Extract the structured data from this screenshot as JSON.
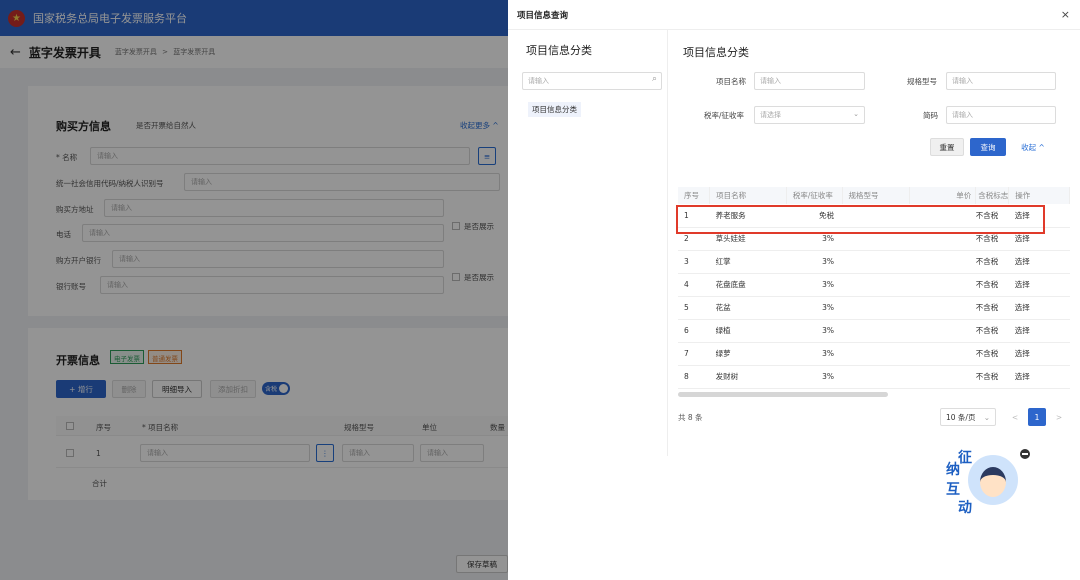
{
  "header": {
    "site_title": "国家税务总局电子发票服务平台"
  },
  "subheader": {
    "back_icon": "←",
    "page_title": "蓝字发票开具",
    "crumb_1": "蓝字发票开具",
    "crumb_sep": ">",
    "crumb_2": "蓝字发票开具"
  },
  "buyer": {
    "section_title": "购买方信息",
    "natural_person_label": "是否开票给自然人",
    "collapse_more": "收起更多 ^",
    "name_label": "* 名称",
    "name_placeholder": "请输入",
    "tax_id_label": "统一社会信用代码/纳税人识别号",
    "tax_id_placeholder": "请输入",
    "address_label": "购买方地址",
    "address_placeholder": "请输入",
    "phone_label": "电话",
    "phone_placeholder": "请输入",
    "show_label_1": "是否展示",
    "bank_label": "购方开户银行",
    "bank_placeholder": "请输入",
    "account_label": "银行账号",
    "account_placeholder": "请输入",
    "show_label_2": "是否展示"
  },
  "invoice": {
    "section_title": "开票信息",
    "tag_electronic": "电子发票",
    "tag_normal": "普通发票",
    "add_row": "+ 增行",
    "delete": "删除",
    "import_details": "明细导入",
    "add_discount": "添加折扣",
    "tax_included_toggle": "含税",
    "col_seq": "序号",
    "col_item_name": "* 项目名称",
    "col_spec": "规格型号",
    "col_unit": "单位",
    "col_qty": "数量",
    "row_seq": "1",
    "row_placeholder": "请输入",
    "total_label": "合计"
  },
  "footer": {
    "save_draft": "保存草稿"
  },
  "modal": {
    "title": "项目信息查询",
    "close": "×",
    "left_title": "项目信息分类",
    "search_placeholder": "请输入",
    "tree_item": "项目信息分类",
    "right_title": "项目信息分类",
    "q_item_name_label": "项目名称",
    "q_item_name_placeholder": "请输入",
    "q_spec_label": "规格型号",
    "q_spec_placeholder": "请输入",
    "q_tax_rate_label": "税率/征收率",
    "q_tax_rate_placeholder": "请选择",
    "q_short_code_label": "简码",
    "q_short_code_placeholder": "请输入",
    "reset": "重置",
    "query": "查询",
    "collapse": "收起 ^",
    "columns": [
      "序号",
      "项目名称",
      "税率/征收率",
      "规格型号",
      "单价",
      "含税标志",
      "操作"
    ],
    "rows": [
      {
        "seq": "1",
        "name": "养老服务",
        "rate": "免税",
        "tax": "不含税",
        "op": "选择"
      },
      {
        "seq": "2",
        "name": "草头娃娃",
        "rate": "3%",
        "tax": "不含税",
        "op": "选择"
      },
      {
        "seq": "3",
        "name": "红掌",
        "rate": "3%",
        "tax": "不含税",
        "op": "选择"
      },
      {
        "seq": "4",
        "name": "花盘底盘",
        "rate": "3%",
        "tax": "不含税",
        "op": "选择"
      },
      {
        "seq": "5",
        "name": "花盆",
        "rate": "3%",
        "tax": "不含税",
        "op": "选择"
      },
      {
        "seq": "6",
        "name": "绿植",
        "rate": "3%",
        "tax": "不含税",
        "op": "选择"
      },
      {
        "seq": "7",
        "name": "绿萝",
        "rate": "3%",
        "tax": "不含税",
        "op": "选择"
      },
      {
        "seq": "8",
        "name": "发财树",
        "rate": "3%",
        "tax": "不含税",
        "op": "选择"
      }
    ],
    "total": "共 8 条",
    "page_size": "10 条/页",
    "page_prev": "<",
    "page_current": "1",
    "page_next": ">"
  },
  "mascot": {
    "chars": [
      "征",
      "纳",
      "互",
      "动"
    ]
  },
  "colors": {
    "primary": "#2d66cc",
    "highlight": "#e03a2a",
    "link": "#2a6fd6"
  }
}
